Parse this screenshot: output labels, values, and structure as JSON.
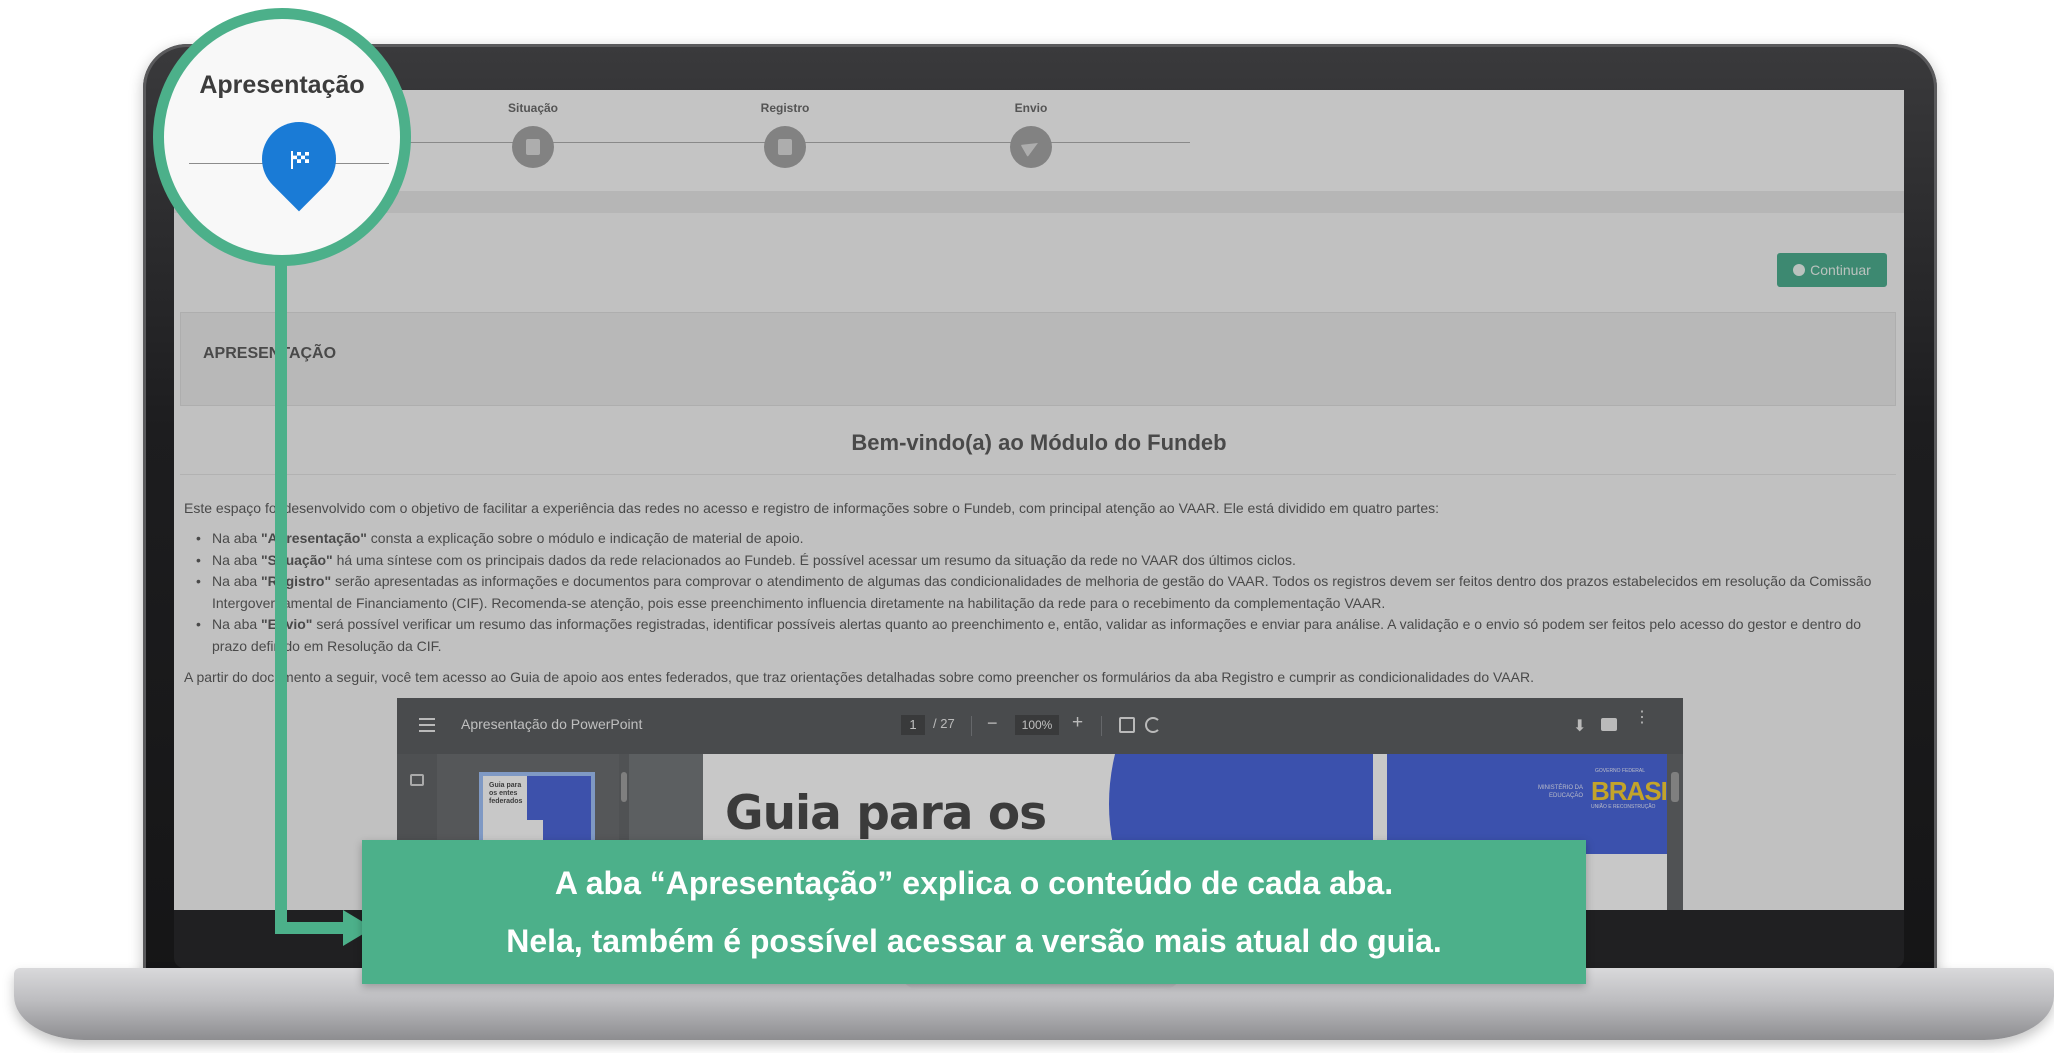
{
  "stepper": {
    "steps": [
      {
        "label": "Apresentação",
        "icon": "flag-icon"
      },
      {
        "label": "Situação",
        "icon": "document-icon"
      },
      {
        "label": "Registro",
        "icon": "file-icon"
      },
      {
        "label": "Envio",
        "icon": "send-icon"
      }
    ]
  },
  "toolbar": {
    "continue_label": "Continuar",
    "continue_icon": "arrow-circle-icon"
  },
  "section": {
    "header": "APRESENTAÇÃO"
  },
  "content": {
    "title": "Bem-vindo(a) ao Módulo do Fundeb",
    "intro": "Este espaço foi desenvolvido com o objetivo de facilitar a experiência das redes no acesso e registro de informações sobre o Fundeb, com principal atenção ao VAAR. Ele está dividido em quatro partes:",
    "bullets": [
      {
        "prefix": "Na aba ",
        "tab": "\"Apresentação\"",
        "text": " consta a explicação sobre o módulo e indicação de material de apoio."
      },
      {
        "prefix": "Na aba ",
        "tab": "\"Situação\"",
        "text": " há uma síntese com os principais dados da rede relacionados ao Fundeb. É possível acessar um resumo da situação da rede no VAAR dos últimos ciclos."
      },
      {
        "prefix": "Na aba ",
        "tab": "\"Registro\"",
        "text": " serão apresentadas as informações e documentos para comprovar o atendimento de algumas das condicionalidades de melhoria de gestão do VAAR. Todos os registros devem ser feitos dentro dos prazos estabelecidos em resolução da Comissão Intergovernamental de Financiamento (CIF). Recomenda-se atenção, pois esse preenchimento influencia diretamente na habilitação da rede para o recebimento da complementação VAAR."
      },
      {
        "prefix": "Na aba ",
        "tab": "\"Envio\"",
        "text": " será possível verificar um resumo das informações registradas, identificar possíveis alertas quanto ao preenchimento e, então, validar as informações e enviar para análise. A validação e o envio só podem ser feitos pelo acesso do gestor e dentro do prazo definido em Resolução da CIF."
      }
    ],
    "after": "A partir do documento a seguir, você tem acesso ao Guia de apoio aos entes federados, que traz orientações detalhadas sobre como preencher os formulários da aba Registro e cumprir as condicionalidades do VAAR."
  },
  "pdf": {
    "title": "Apresentação do PowerPoint",
    "page_current": "1",
    "page_total": "/ 27",
    "zoom": "100%",
    "zoom_minus": "−",
    "zoom_plus": "+",
    "thumb_text": "Guia para os entes federados",
    "slide_headline": "Guia para os",
    "ministerio": "MINISTÉRIO DA EDUCAÇÃO",
    "gov_label": "GOVERNO FEDERAL",
    "brasil": "BRASIL",
    "brasil_sub": "UNIÃO E RECONSTRUÇÃO"
  },
  "annotation": {
    "zoom_label": "Apresentação",
    "callout_line1": "A aba “Apresentação” explica o conteúdo de cada aba.",
    "callout_line2": "Nela, também é possível acessar a versão mais atual do guia.",
    "accent_color": "#4cb08a",
    "pin_color": "#1a7bd6"
  }
}
